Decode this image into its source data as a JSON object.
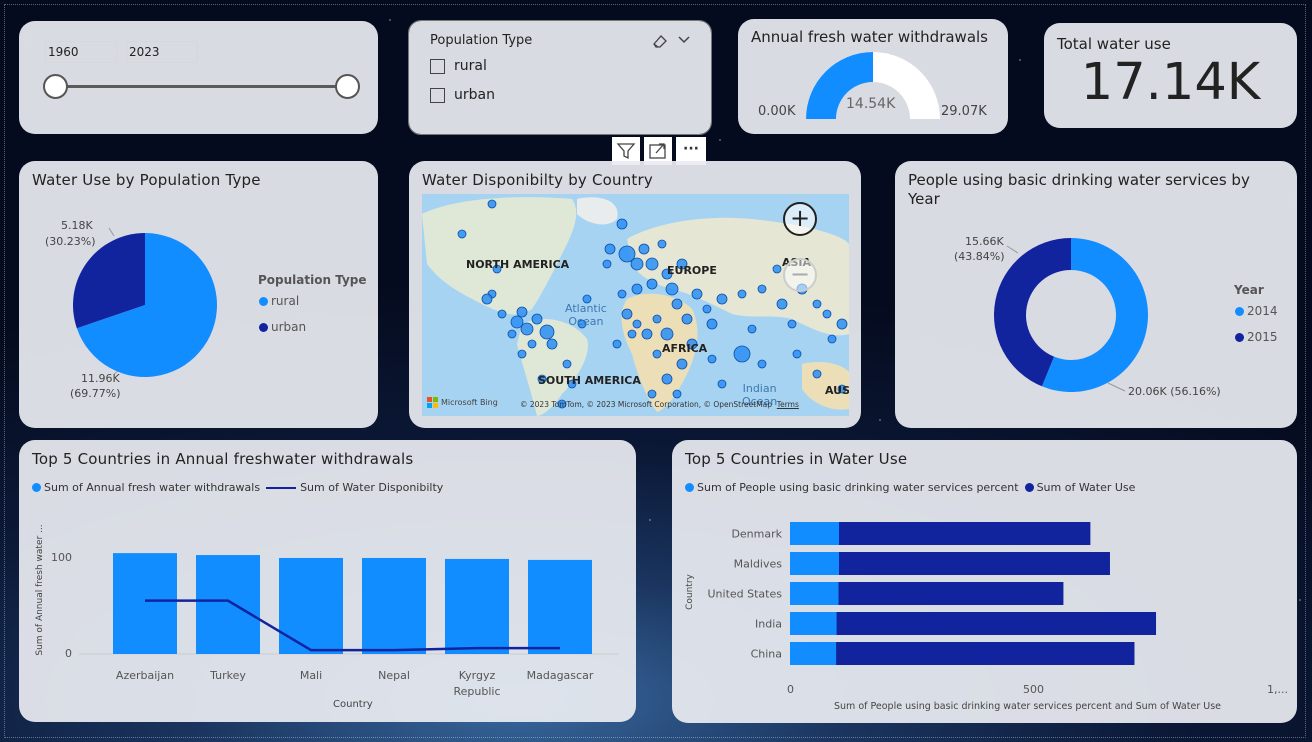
{
  "slicer": {
    "start": "1960",
    "end": "2023"
  },
  "pop_filter": {
    "title": "Population Type",
    "options": [
      "rural",
      "urban"
    ]
  },
  "gauge": {
    "title": "Annual fresh water withdrawals",
    "min": "0.00K",
    "value": "14.54K",
    "max": "29.07K",
    "fraction": 0.5
  },
  "kpi": {
    "title": "Total water use",
    "value": "17.14K"
  },
  "visual_toolbar": {
    "filter_icon": "filter-icon",
    "focus_icon": "focus-mode-icon",
    "more": "···"
  },
  "colors": {
    "light": "#118dff",
    "dark": "#12239e"
  },
  "pie": {
    "title": "Water Use by Population Type",
    "legend_title": "Population Type",
    "urban_value": "5.18K",
    "urban_pct": "(30.23%)",
    "rural_value": "11.96K",
    "rural_pct": "(69.77%)",
    "legend": [
      "rural",
      "urban"
    ]
  },
  "map": {
    "title": "Water Disponibilty by Country",
    "labels": {
      "na": "NORTH AMERICA",
      "eu": "EUROPE",
      "as": "ASIA",
      "af": "AFRICA",
      "sa": "SOUTH AMERICA",
      "au": "AUST",
      "atl1": "Atlantic",
      "atl2": "Ocean",
      "ind1": "Indian",
      "ind2": "Ocean"
    },
    "zoom_in": "+",
    "zoom_out": "−",
    "bing": "Microsoft Bing",
    "attribution": "© 2023 TomTom, © 2023 Microsoft Corporation, © OpenStreetMap",
    "terms": "Terms"
  },
  "donut": {
    "title": "People using basic drinking water services by Year",
    "v2015": "15.66K",
    "p2015": "(43.84%)",
    "v2014": "20.06K (56.16%)",
    "legend_title": "Year",
    "legend": [
      "2014",
      "2015"
    ]
  },
  "bar_chart": {
    "title": "Top 5 Countries in Annual freshwater withdrawals",
    "legend": [
      "Sum of Annual fresh water withdrawals",
      "Sum of Water Disponibilty"
    ],
    "ylabel": "Sum of Annual fresh water ...",
    "xlabel": "Country",
    "yticks": [
      "100",
      "0"
    ]
  },
  "hbar_chart": {
    "title": "Top 5 Countries in Water Use",
    "legend": [
      "Sum of People using basic drinking water services percent",
      "Sum of Water Use"
    ],
    "ylabel": "Country",
    "xlabel": "Sum of People using basic drinking water services percent and Sum of Water Use",
    "xticks": [
      "0",
      "500",
      "1,..."
    ]
  },
  "chart_data": [
    {
      "type": "pie",
      "title": "Water Use by Population Type",
      "categories": [
        "rural",
        "urban"
      ],
      "values": [
        11.96,
        5.18
      ],
      "unit": "K"
    },
    {
      "type": "donut",
      "title": "People using basic drinking water services by Year",
      "categories": [
        "2014",
        "2015"
      ],
      "values": [
        20.06,
        15.66
      ],
      "unit": "K"
    },
    {
      "type": "bar",
      "title": "Top 5 Countries in Annual freshwater withdrawals",
      "categories": [
        "Azerbaijan",
        "Turkey",
        "Mali",
        "Nepal",
        "Kyrgyz Republic",
        "Madagascar"
      ],
      "series": [
        {
          "name": "Sum of Annual fresh water withdrawals",
          "values": [
            104,
            102,
            99,
            99,
            98,
            97
          ]
        },
        {
          "name": "Sum of Water Disponibilty",
          "values": [
            55,
            55,
            4,
            4,
            6,
            6
          ]
        }
      ],
      "xlabel": "Country",
      "ylabel": "Sum of Annual fresh water ...",
      "ylim": [
        0,
        100
      ]
    },
    {
      "type": "bar",
      "orientation": "horizontal",
      "stacked": true,
      "title": "Top 5 Countries in Water Use",
      "categories": [
        "Denmark",
        "Maldives",
        "United States",
        "India",
        "China"
      ],
      "series": [
        {
          "name": "Sum of People using basic drinking water services percent",
          "values": [
            100,
            100,
            99,
            95,
            94
          ]
        },
        {
          "name": "Sum of Water Use",
          "values": [
            513,
            553,
            459,
            652,
            609
          ]
        }
      ],
      "xlabel": "Sum of People using basic drinking water services percent and Sum of Water Use",
      "ylabel": "Country",
      "xlim": [
        0,
        1000
      ]
    }
  ]
}
